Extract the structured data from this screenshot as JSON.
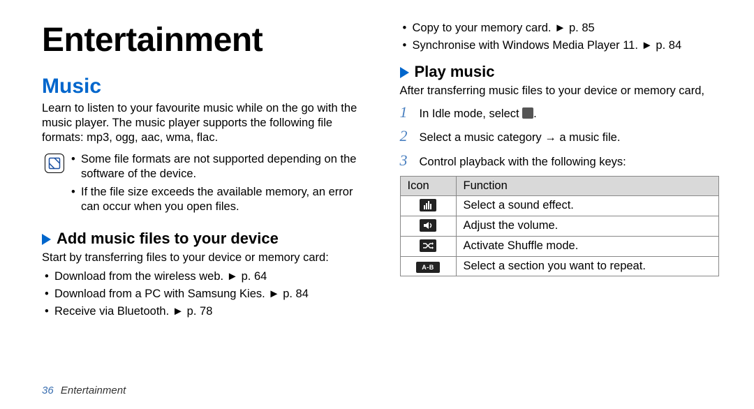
{
  "chapter": "Entertainment",
  "left": {
    "section": "Music",
    "intro": "Learn to listen to your favourite music while on the go with the music player. The music player supports the following file formats: mp3, ogg, aac, wma, flac.",
    "notes": [
      "Some file formats are not supported depending on the software of the device.",
      "If the file size exceeds the available memory, an error can occur when you open files."
    ],
    "sub": "Add music files to your device",
    "sub_intro": "Start by transferring files to your device or memory card:",
    "bullets": [
      "Download from the wireless web. ► p. 64",
      "Download from a PC with Samsung Kies. ► p. 84",
      "Receive via Bluetooth. ► p. 78"
    ]
  },
  "right": {
    "top_bullets": [
      "Copy to your memory card. ► p. 85",
      "Synchronise with Windows Media Player 11. ► p. 84"
    ],
    "sub": "Play music",
    "sub_intro": "After transferring music files to your device or memory card,",
    "step1_prefix": "In Idle mode, select ",
    "step1_suffix": ".",
    "step2": "Select a music category → a music file.",
    "step3": "Control playback with the following keys:",
    "table": {
      "head_icon": "Icon",
      "head_func": "Function",
      "rows": [
        {
          "icon": "eq",
          "func": "Select a sound effect."
        },
        {
          "icon": "speaker",
          "func": "Adjust the volume."
        },
        {
          "icon": "shuffle",
          "func": "Activate Shuffle mode."
        },
        {
          "icon": "ab",
          "func": "Select a section you want to repeat."
        }
      ]
    }
  },
  "footer": {
    "page": "36",
    "label": "Entertainment"
  }
}
